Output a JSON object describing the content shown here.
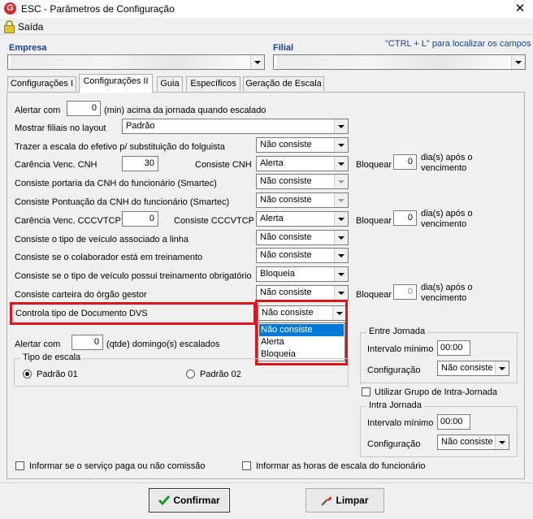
{
  "window": {
    "app_icon": "G",
    "title": "ESC - Parâmetros de Configuração",
    "close": "✕"
  },
  "menu": {
    "saida": "Saída"
  },
  "header": {
    "empresa_label": "Empresa",
    "filial_label": "Filial",
    "hint": "\"CTRL + L\" para localizar os campos"
  },
  "tabs": [
    "Configurações I",
    "Configurações II",
    "Guia",
    "Específicos",
    "Geração de Escala"
  ],
  "form": {
    "alertar_com_label": "Alertar com",
    "alertar_com_value": "0",
    "alertar_com_suffix": "(min) acima da jornada quando escalado",
    "mostrar_filiais_label": "Mostrar filiais no layout",
    "mostrar_filiais_value": "Padrão",
    "trazer_escala_label": "Trazer a escala do efetivo p/ substituição do folguista",
    "trazer_escala_value": "Não consiste",
    "carencia_cnh_label": "Carência Venc. CNH",
    "carencia_cnh_value": "30",
    "consiste_cnh_label": "Consiste CNH",
    "consiste_cnh_value": "Alerta",
    "bloquear_label": "Bloquear",
    "bloquear1_value": "0",
    "dias_apos_1": "dia(s) após o",
    "dias_apos_2": "vencimento",
    "portaria_cnh_label": "Consiste portaria da CNH do funcionário (Smartec)",
    "portaria_cnh_value": "Não consiste",
    "pontuacao_cnh_label": "Consiste Pontuação da CNH do funcionário (Smartec)",
    "pontuacao_cnh_value": "Não consiste",
    "carencia_cccvtcp_label": "Carência Venc. CCCVTCP",
    "carencia_cccvtcp_value": "0",
    "consiste_cccvtcp_label": "Consiste CCCVTCP",
    "consiste_cccvtcp_value": "Alerta",
    "bloquear2_value": "0",
    "tipo_veiculo_label": "Consiste o tipo de veículo associado a linha",
    "tipo_veiculo_value": "Não consiste",
    "colaborador_treinamento_label": "Consiste se o colaborador está em treinamento",
    "colaborador_treinamento_value": "Não consiste",
    "veiculo_treinamento_label": "Consiste se o tipo de veículo possui treinamento obrigatório",
    "veiculo_treinamento_value": "Bloqueia",
    "carteira_orgao_label": "Consiste carteira do órgão gestor",
    "carteira_orgao_value": "Não consiste",
    "bloquear3_value": "0",
    "controla_dvs_label": "Controla tipo de Documento DVS",
    "controla_dvs_value": "Não consiste",
    "dvs_options": [
      "Não consiste",
      "Alerta",
      "Bloqueia"
    ],
    "alertar_domingos_label": "Alertar com",
    "alertar_domingos_value": "0",
    "alertar_domingos_suffix": "(qtde) domingo(s) escalados",
    "tipo_escala_legend": "Tipo de escala",
    "padrao01": "Padrão 01",
    "padrao02": "Padrão 02",
    "entre_jornada_legend": "Entre Jornada",
    "intervalo_minimo_label": "Intervalo mínimo",
    "entre_intervalo_value": "00:00",
    "configuracao_label": "Configuração",
    "entre_config_value": "Não consiste",
    "utilizar_grupo_label": "Utilizar Grupo de Intra-Jornada",
    "intra_jornada_legend": "Intra Jornada",
    "intra_intervalo_value": "00:00",
    "intra_config_value": "Não consiste",
    "informar_servico_label": "Informar se o serviço paga ou não comissão",
    "informar_horas_label": "Informar as horas de escala do funcionário"
  },
  "buttons": {
    "confirmar": "Confirmar",
    "limpar": "Limpar"
  },
  "colors": {
    "highlight": "#e0141c",
    "selection": "#0078d7",
    "label_blue": "#1a3f8f"
  }
}
